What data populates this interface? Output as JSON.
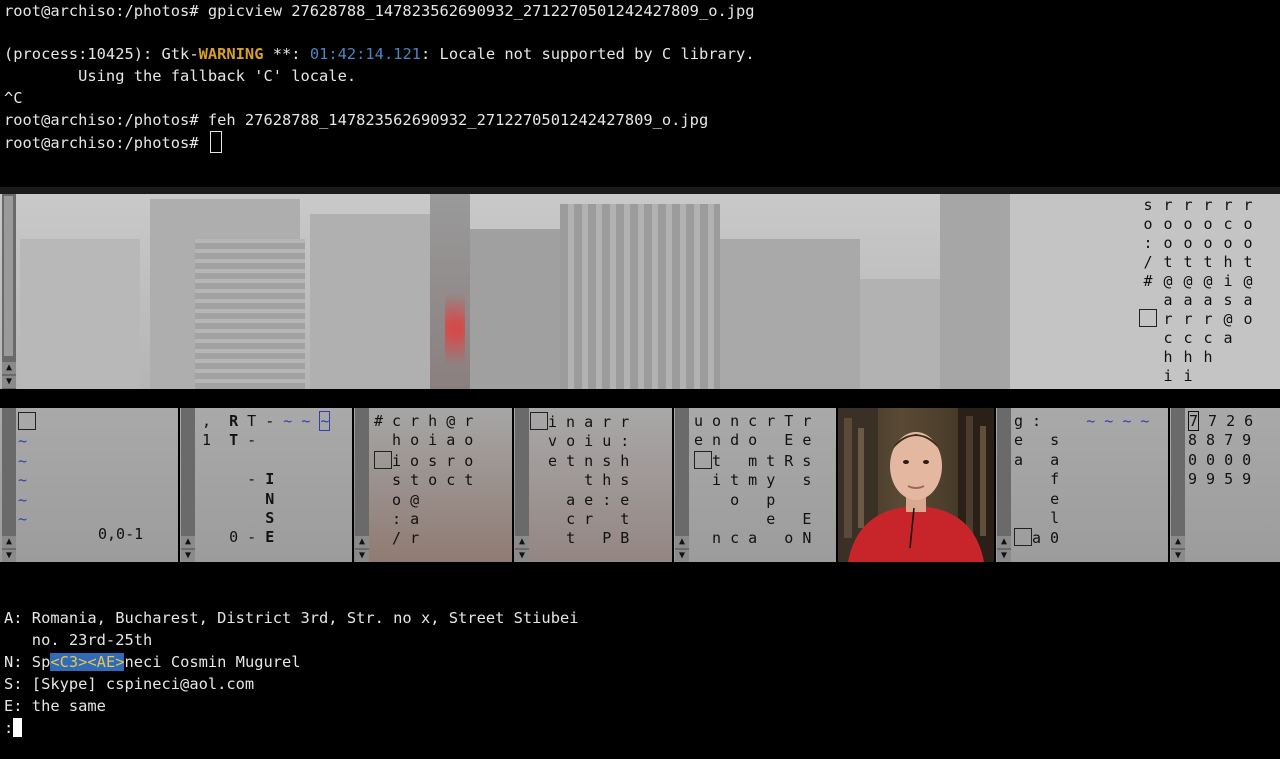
{
  "terminal": {
    "lines": [
      "root@archiso:/photos# gpicview 27628788_147823562690932_2712270501242427809_o.jpg",
      "",
      "(process:10425): Gtk-",
      "WARNING",
      " **: ",
      "01:42:14.121",
      ": Locale not supported by C library.",
      "        Using the fallback 'C' locale.",
      "^C",
      "root@archiso:/photos# feh 27628788_147823562690932_2712270501242427809_o.jpg",
      "root@archiso:/photos# "
    ]
  },
  "strip_text": {
    "columns": [
      [
        "s",
        "o",
        ":",
        "/",
        "#",
        "",
        "",
        "",
        ""
      ],
      [
        "r",
        "o",
        "o",
        "t",
        "@",
        "a",
        "r",
        "c",
        "h",
        "i"
      ],
      [
        "r",
        "o",
        "o",
        "t",
        "@",
        "a",
        "r",
        "c",
        "h",
        "i"
      ],
      [
        "r",
        "o",
        "o",
        "t",
        "@",
        "a",
        "r",
        "c",
        "h"
      ],
      [
        "r",
        "c",
        "o",
        "i",
        "s",
        "a"
      ],
      [
        "r",
        "o",
        "h",
        "t",
        "@",
        "a"
      ]
    ]
  },
  "panes": {
    "p1": {
      "line": "0,0-1"
    },
    "p2": {
      "a": ",  R T -",
      "b": "1  T -",
      "c": "I",
      "d": "N",
      "e": "S",
      "f": "E",
      "g": "0 -"
    },
    "p3": {
      "rows": [
        "# c r h @ r",
        "  h o i a o",
        "  i o s r o",
        "  s t o c t",
        "  o @",
        "  : a",
        "  / r"
      ]
    },
    "p4": {
      "rows": [
        "  i n a r r",
        "  v o i u :",
        "  e t n s h",
        "      t h s",
        "    a e : e",
        "    c r   t",
        "    t   P B"
      ]
    },
    "p5": {
      "rows": [
        "u o n c r T r",
        "e n d o   E e",
        "  t   m t R s",
        "  i t m y   s",
        "    o   p",
        "        e   E",
        "  n c a   o N"
      ]
    },
    "p6": {
      "rows": [
        "g :",
        "e   s",
        "a   a",
        "    f",
        "    e",
        "    l",
        "  a 0"
      ]
    },
    "p7": {
      "rows": [
        "7 7 2 6",
        "8 8 7 9",
        "0 0 0 0",
        "9 9 5 9"
      ]
    }
  },
  "contact": {
    "address_line1": "A: Romania, Bucharest, District 3rd, Str. no x, Street Stiubei",
    "address_line2": "   no. 23rd-25th",
    "name_prefix": "N: Sp",
    "name_highlight": "<C3><AE>",
    "name_suffix": "neci Cosmin Mugurel",
    "skype": "S: [Skype] cspineci@aol.com",
    "email": "E: the same",
    "prompt": ":"
  },
  "colors": {
    "warning": "#d8a02a",
    "timestamp": "#4a84c4",
    "highlight_bg": "#2f6bb8",
    "highlight_fg": "#e9c64a",
    "vim_blue": "#2f3fae",
    "vim_green": "#1e9a1e"
  }
}
